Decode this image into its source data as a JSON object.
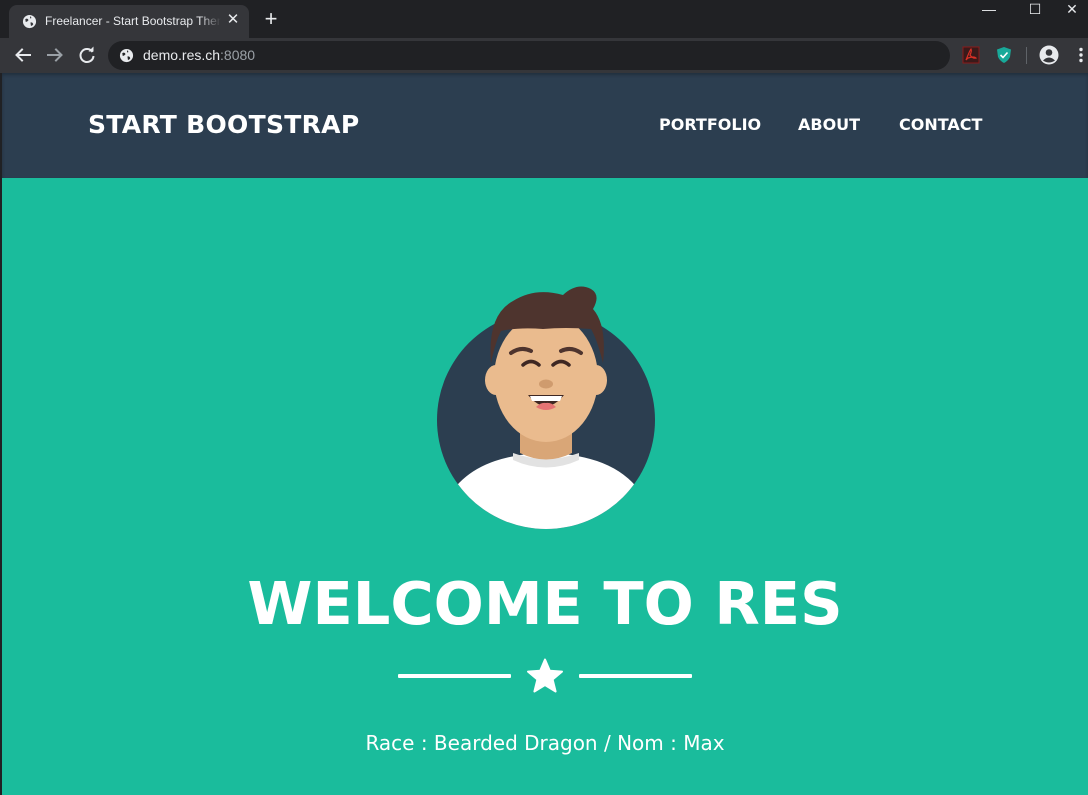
{
  "browser": {
    "tab_title": "Freelancer - Start Bootstrap Theme",
    "tab_close": "✕",
    "new_tab": "+",
    "url_host": "demo.res.ch",
    "url_port": ":8080",
    "window_controls": {
      "minimize": "—",
      "maximize": "☐",
      "close": "✕"
    },
    "icons": [
      "globe-icon",
      "back-icon",
      "forward-icon",
      "reload-icon",
      "pdf-extension-icon",
      "shield-extension-icon",
      "profile-icon",
      "menu-icon"
    ]
  },
  "site": {
    "brand": "START BOOTSTRAP",
    "nav": [
      {
        "label": "PORTFOLIO"
      },
      {
        "label": "ABOUT"
      },
      {
        "label": "CONTACT"
      }
    ],
    "masthead": {
      "heading": "WELCOME TO RES",
      "divider_icon": "star-icon",
      "subheading": "Race : Bearded Dragon / Nom : Max"
    }
  },
  "colors": {
    "titlebar": "#202124",
    "toolbar": "#35363a",
    "navbar": "#2c3e50",
    "primary": "#1abc9c",
    "text": "#ffffff"
  }
}
